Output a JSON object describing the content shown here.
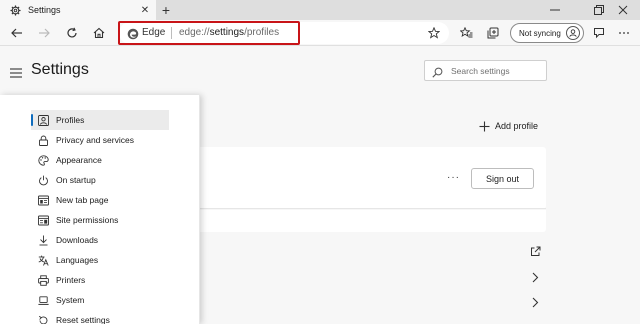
{
  "tab": {
    "title": "Settings",
    "close_glyph": "✕",
    "icon": "gear-icon"
  },
  "newtab_glyph": "+",
  "window": {
    "minimize_glyph": "—",
    "restore_glyph": "❐"
  },
  "toolbar": {
    "edge_label": "Edge",
    "url_prefix": "edge://",
    "url_host": "settings",
    "url_path": "/profiles",
    "sync_label": "Not syncing"
  },
  "settings": {
    "title": "Settings",
    "search_placeholder": "Search settings"
  },
  "sidebar": {
    "items": [
      {
        "label": "Profiles",
        "icon": "profile-icon",
        "selected": true
      },
      {
        "label": "Privacy and services",
        "icon": "lock-icon"
      },
      {
        "label": "Appearance",
        "icon": "palette-icon"
      },
      {
        "label": "On startup",
        "icon": "power-icon"
      },
      {
        "label": "New tab page",
        "icon": "new-tab-icon"
      },
      {
        "label": "Site permissions",
        "icon": "site-permissions-icon"
      },
      {
        "label": "Downloads",
        "icon": "download-icon"
      },
      {
        "label": "Languages",
        "icon": "language-icon"
      },
      {
        "label": "Printers",
        "icon": "printer-icon"
      },
      {
        "label": "System",
        "icon": "laptop-icon"
      },
      {
        "label": "Reset settings",
        "icon": "reset-icon"
      }
    ]
  },
  "main": {
    "add_profile_label": "Add profile",
    "more_glyph": "···",
    "sign_out_label": "Sign out"
  },
  "colors": {
    "highlight_border": "#c81418",
    "accent": "#0f6cbd"
  }
}
